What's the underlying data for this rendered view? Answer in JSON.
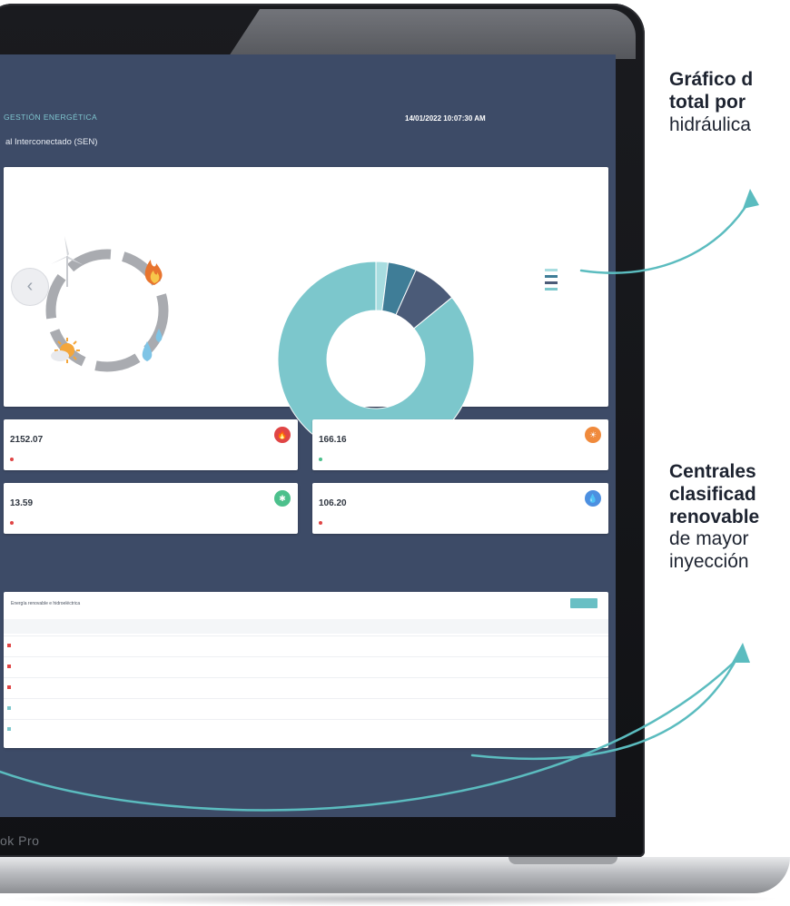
{
  "device": {
    "brand_label": "ok Pro"
  },
  "app": {
    "title": "GESTIÓN ENERGÉTICA",
    "subtitle": "al Interconectado (SEN)",
    "datetime": "14/01/2022 10:07:30 AM"
  },
  "generation_card": {
    "caption": "",
    "title": "",
    "legend": [
      {
        "label": "",
        "color": "#a8dde0"
      },
      {
        "label": "",
        "color": "#3f7d97"
      },
      {
        "label": "",
        "color": "#4b5b78"
      },
      {
        "label": "",
        "color": "#7cc7cc"
      }
    ]
  },
  "chart_data": {
    "type": "pie",
    "donut": true,
    "values": [
      2.0,
      4.7,
      7.4,
      85.9
    ],
    "colors": [
      "#a8dde0",
      "#3f7d97",
      "#4b5b78",
      "#7cc7cc"
    ]
  },
  "stats": [
    {
      "label": "",
      "value": "2152.07",
      "foot": "",
      "icon": "flame-icon",
      "color": "#e04545"
    },
    {
      "label": "",
      "value": "166.16",
      "foot": "",
      "icon": "sun-icon",
      "color": "#f08a3c"
    },
    {
      "label": "",
      "value": "13.59",
      "foot": "",
      "icon": "wind-icon",
      "color": "#4cc08c"
    },
    {
      "label": "",
      "value": "106.20",
      "foot": "",
      "icon": "water-drop-icon",
      "color": "#4c8fe0"
    }
  ],
  "table": {
    "title": "Energía renovable e hidroeléctrica",
    "button_label": "",
    "headers": [
      "",
      "",
      "",
      ""
    ],
    "rows": [
      {
        "name": "",
        "v1": "",
        "v2": "",
        "trend": "",
        "flag": "#e04545",
        "trend_dir": "up"
      },
      {
        "name": "",
        "v1": "",
        "v2": "",
        "trend": "",
        "flag": "#e04545",
        "trend_dir": "up"
      },
      {
        "name": "",
        "v1": "",
        "v2": "",
        "trend": "",
        "flag": "#e04545",
        "trend_dir": "up"
      },
      {
        "name": "",
        "v1": "",
        "v2": "",
        "trend": "",
        "flag": "#7cc7cc",
        "trend_dir": "up"
      },
      {
        "name": "",
        "v1": "",
        "v2": "",
        "trend": "",
        "flag": "#7cc7cc",
        "trend_dir": "down"
      }
    ]
  },
  "annotations": {
    "note1": {
      "line1": "Gráfico d",
      "line2": "total por",
      "line3": "hidráulica"
    },
    "note2": {
      "line1": "Centrales",
      "line2": "clasificad",
      "line3": "renovable",
      "line4": "de mayor",
      "line5": "inyección"
    }
  }
}
